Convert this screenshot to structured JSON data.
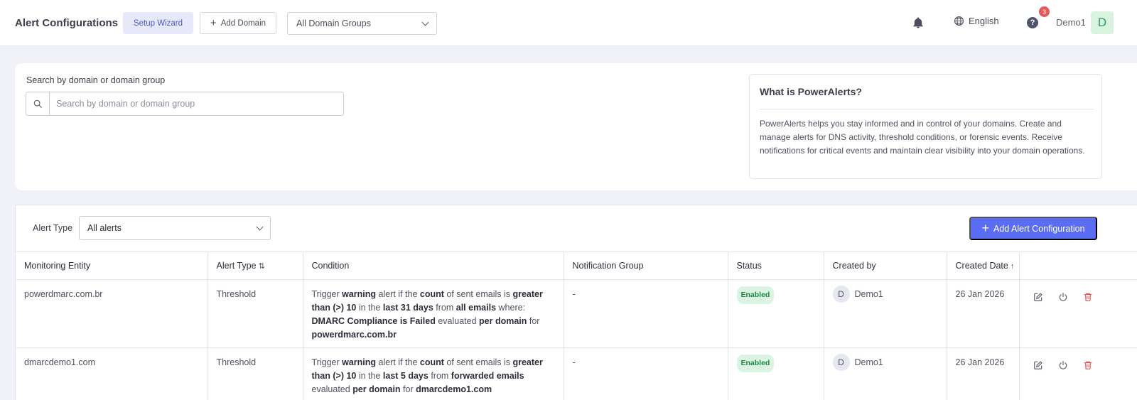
{
  "header": {
    "title": "Alert Configurations",
    "setup_wizard_label": "Setup Wizard",
    "add_domain_label": "Add Domain",
    "domain_groups_value": "All Domain Groups",
    "language": "English",
    "help_badge_count": "3",
    "user_name": "Demo1",
    "user_initial": "D"
  },
  "search": {
    "label": "Search by domain or domain group",
    "placeholder": "Search by domain or domain group",
    "value": ""
  },
  "info": {
    "title": "What is PowerAlerts?",
    "text": "PowerAlerts helps you stay informed and in control of your domains. Create and manage alerts for DNS activity, threshold conditions, or forensic events. Receive notifications for critical events and maintain clear visibility into your domain operations."
  },
  "filters": {
    "alert_type_label": "Alert Type",
    "alert_type_value": "All alerts",
    "add_alert_label": "Add Alert Configuration"
  },
  "table": {
    "columns": [
      "Monitoring Entity",
      "Alert Type",
      "Condition",
      "Notification Group",
      "Status",
      "Created by",
      "Created Date"
    ],
    "rows": [
      {
        "entity": "powerdmarc.com.br",
        "alert_type": "Threshold",
        "condition": {
          "p1": "Trigger ",
          "severity": "warning",
          "p2": " alert if the ",
          "metric": "count",
          "p3": " of sent emails is ",
          "operator": "greater than (>) 10",
          "p4": " in the ",
          "period": "last 31 days",
          "p5": " from ",
          "source": "all emails",
          "p6": "  where: ",
          "filter": "DMARC Compliance is Failed",
          "p7": "  evaluated ",
          "scope": "per domain",
          "p8": " for ",
          "target": "powerdmarc.com.br"
        },
        "notification_group": "-",
        "status": "Enabled",
        "created_by_initial": "D",
        "created_by": "Demo1",
        "created_date": "26 Jan 2026"
      },
      {
        "entity": "dmarcdemo1.com",
        "alert_type": "Threshold",
        "condition": {
          "p1": "Trigger ",
          "severity": "warning",
          "p2": " alert if the ",
          "metric": "count",
          "p3": " of sent emails is ",
          "operator": "greater than (>) 10",
          "p4": " in the ",
          "period": "last 5 days",
          "p5": " from ",
          "source": "forwarded emails",
          "p6": "  evaluated ",
          "scope": "per domain",
          "p7": " for ",
          "target": "dmarcdemo1.com"
        },
        "notification_group": "-",
        "status": "Enabled",
        "created_by_initial": "D",
        "created_by": "Demo1",
        "created_date": "26 Jan 2026"
      }
    ]
  },
  "colors": {
    "accent": "#5a6df2",
    "status_enabled_bg": "#dcf5e3",
    "status_enabled_text": "#1e8a44",
    "delete_icon": "#e25a5a",
    "notification_badge": "#e25a5a"
  },
  "icons": [
    "bell-icon",
    "globe-icon",
    "help-icon",
    "search-icon",
    "sort-icon",
    "edit-icon",
    "power-icon",
    "trash-icon",
    "chevron-down-icon",
    "plus-icon"
  ]
}
